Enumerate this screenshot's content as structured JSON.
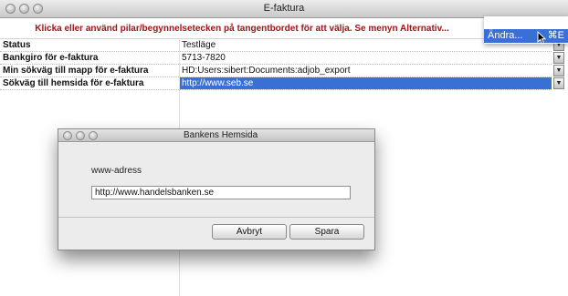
{
  "window": {
    "title": "E-faktura"
  },
  "instruction": "Klicka eller använd pilar/begynnelsetecken på tangentbordet för att välja. Se menyn Alternativ...",
  "rows": [
    {
      "label": "Status",
      "value": "Testläge"
    },
    {
      "label": "Bankgiro för e-faktura",
      "value": "5713-7820"
    },
    {
      "label": "Min sökväg till mapp för e-faktura",
      "value": "HD:Users:sibert:Documents:adjob_export"
    },
    {
      "label": "Sökväg till hemsida för e-faktura",
      "value": "http://www.seb.se"
    }
  ],
  "selected_row": 3,
  "menu": {
    "item_label": "Ändra...",
    "shortcut": "⌘E"
  },
  "dialog": {
    "title": "Bankens Hemsida",
    "field_label": "www-adress",
    "field_value": "http://www.handelsbanken.se",
    "cancel_label": "Avbryt",
    "save_label": "Spara"
  },
  "colors": {
    "instruction": "#a5121a",
    "selection": "#3a6fd6"
  },
  "icons": {
    "dropdown": "triangle-down-icon",
    "cursor": "arrow-cursor-icon"
  }
}
